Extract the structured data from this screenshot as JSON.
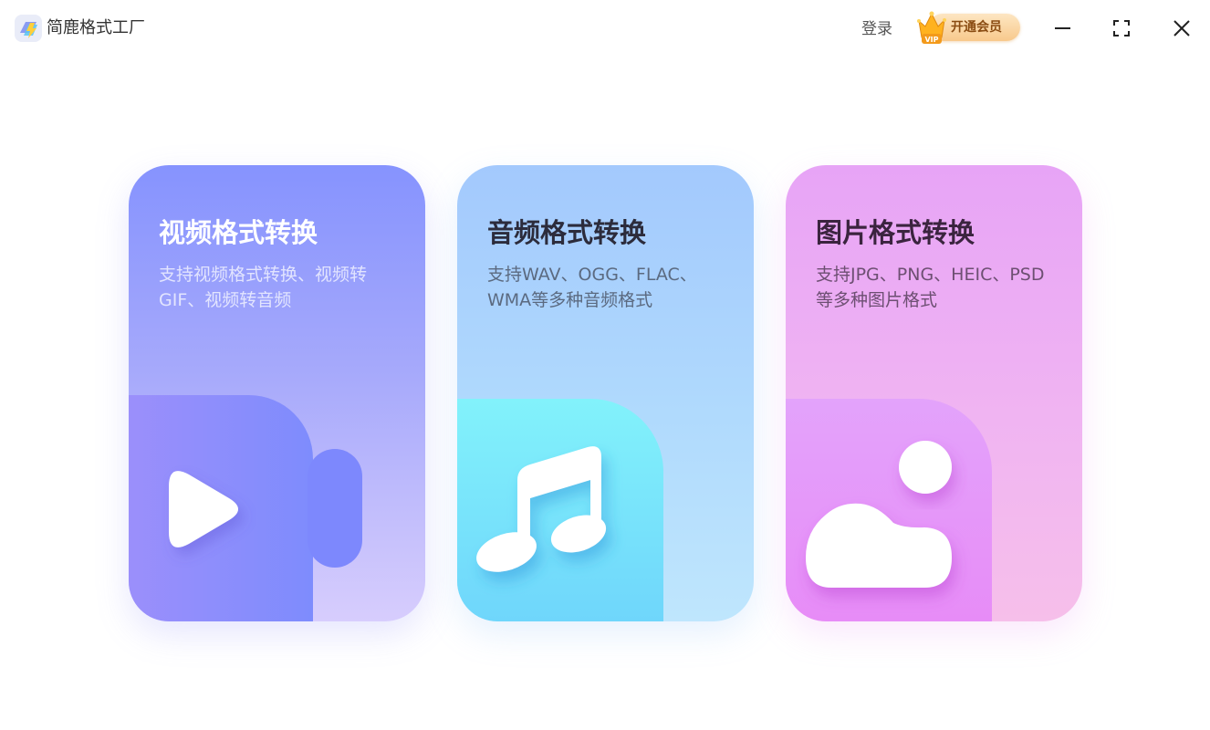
{
  "app": {
    "title": "简鹿格式工厂"
  },
  "header": {
    "login_label": "登录",
    "vip_badge": "VIP",
    "vip_label": "开通会员"
  },
  "window_controls": {
    "minimize_icon": "minimize-icon",
    "maximize_icon": "fullscreen-icon",
    "close_icon": "close-icon"
  },
  "cards": [
    {
      "title": "视频格式转换",
      "description": "支持视频格式转换、视频转GIF、视频转音频",
      "icon": "video-camera-play-icon"
    },
    {
      "title": "音频格式转换",
      "description": "支持WAV、OGG、FLAC、WMA等多种音频格式",
      "icon": "music-note-icon"
    },
    {
      "title": "图片格式转换",
      "description": "支持JPG、PNG、HEIC、PSD等多种图片格式",
      "icon": "image-cloud-icon"
    }
  ],
  "colors": {
    "video_card_top": "#8693fe",
    "video_card_bottom": "#d7cdfd",
    "audio_card_top": "#a3c9fd",
    "audio_card_bottom": "#bfe6fd",
    "image_card_top": "#e7a4f6",
    "image_card_bottom": "#f6bfea",
    "vip_gold": "#f8c98c"
  }
}
